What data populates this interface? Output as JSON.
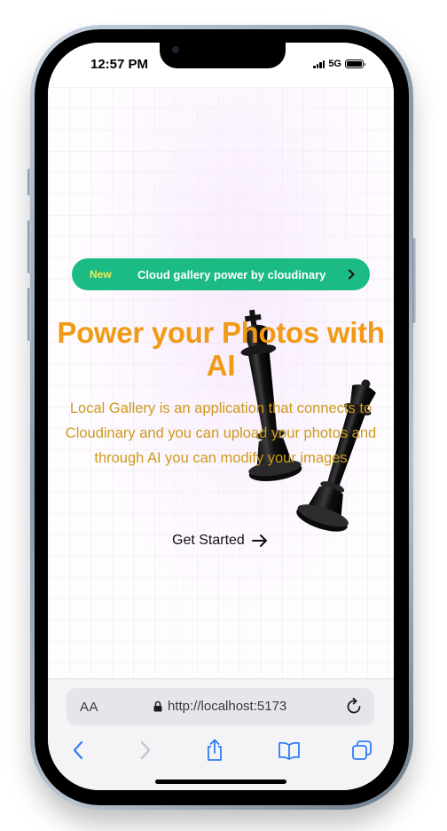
{
  "status_bar": {
    "time": "12:57 PM",
    "network": "5G"
  },
  "announcement": {
    "badge": "New",
    "text": "Cloud gallery power by cloudinary"
  },
  "hero": {
    "title": "Power your Photos with AI",
    "description": "Local Gallery is an application that connects to Cloudinary and you can upload your photos and through AI you can modify your images",
    "cta_label": "Get Started"
  },
  "browser": {
    "text_size_label": "AA",
    "url": "http://localhost:5173"
  },
  "colors": {
    "pill": "#1bbb83",
    "pill_badge": "#f3ea5b",
    "headline": "#f19a16",
    "description": "#cc9a1e",
    "safari_blue": "#2f7cf6"
  },
  "icons": {
    "back": "chevron-left-icon",
    "forward": "chevron-right-icon",
    "share": "share-icon",
    "bookmarks": "book-icon",
    "tabs": "tabs-icon",
    "lock": "lock-icon",
    "reload": "reload-icon"
  }
}
